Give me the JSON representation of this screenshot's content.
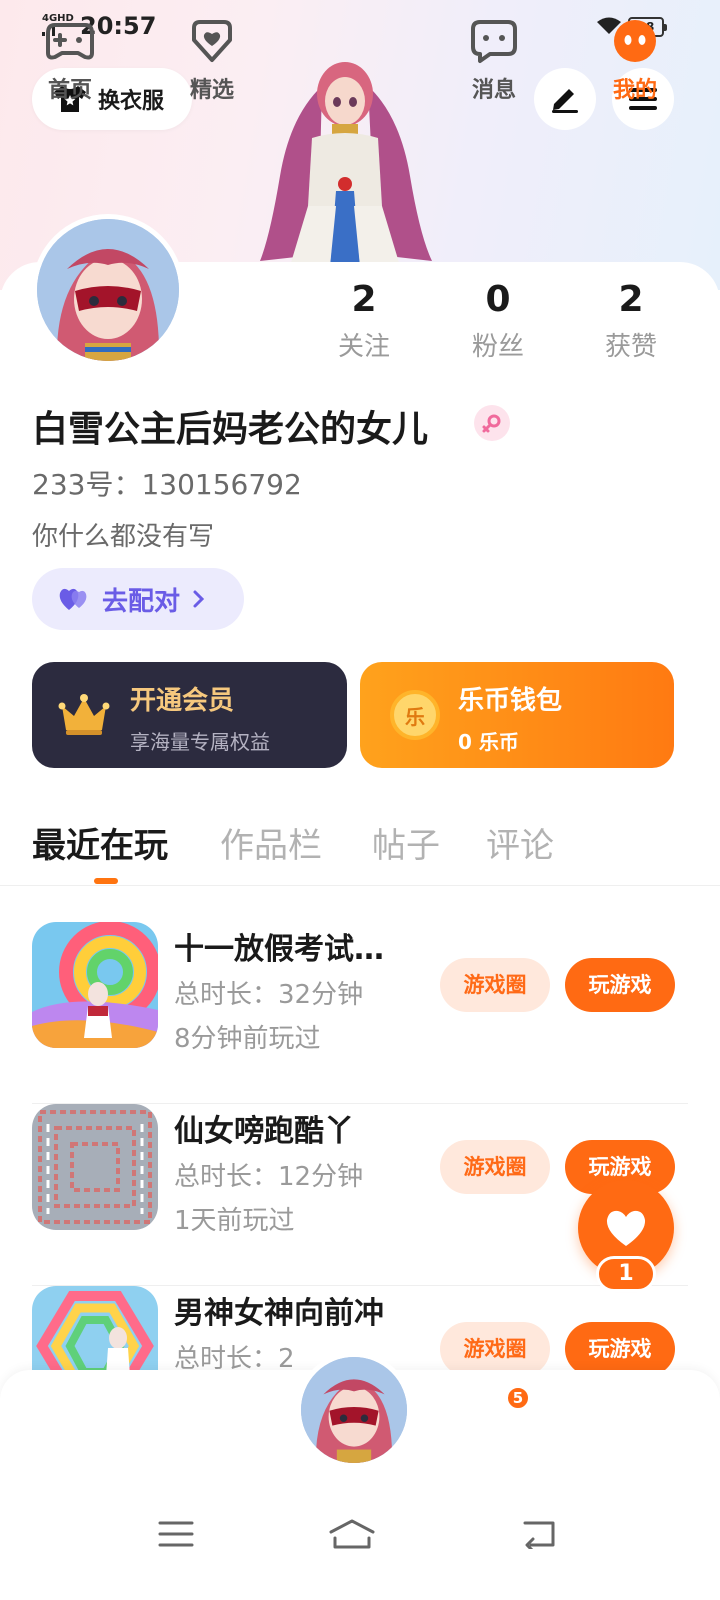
{
  "status_bar": {
    "network": "4GHD",
    "time": "20:57",
    "battery": "48"
  },
  "header": {
    "outfit_button": "换衣服"
  },
  "profile": {
    "stats": [
      {
        "value": "2",
        "label": "关注"
      },
      {
        "value": "0",
        "label": "粉丝"
      },
      {
        "value": "2",
        "label": "获赞"
      }
    ],
    "nickname": "白雪公主后妈老公的女儿",
    "gender_icon": "female-icon",
    "uid": "233号：130156792",
    "bio": "你什么都没有写",
    "match_button": "去配对"
  },
  "cards": {
    "vip": {
      "title": "开通会员",
      "subtitle": "享海量专属权益"
    },
    "wallet": {
      "title": "乐币钱包",
      "subtitle": "0 乐币",
      "coin_glyph": "乐"
    }
  },
  "tabs": [
    {
      "label": "最近在玩",
      "active": true
    },
    {
      "label": "作品栏",
      "active": false
    },
    {
      "label": "帖子",
      "active": false
    },
    {
      "label": "评论",
      "active": false
    }
  ],
  "games": [
    {
      "title": "十一放假考试…",
      "duration": "总时长：32分钟",
      "last_played": "8分钟前玩过",
      "circle_label": "游戏圈",
      "play_label": "玩游戏"
    },
    {
      "title": "仙女嗙跑酷丫",
      "duration": "总时长：12分钟",
      "last_played": "1天前玩过",
      "circle_label": "游戏圈",
      "play_label": "玩游戏"
    },
    {
      "title": "男神女神向前冲",
      "duration": "总时长：2",
      "last_played": "",
      "circle_label": "游戏圈",
      "play_label": "玩游戏"
    }
  ],
  "floating_like": {
    "count": "1"
  },
  "bottom_tabs": [
    {
      "label": "首页",
      "icon": "gamepad-icon"
    },
    {
      "label": "精选",
      "icon": "heart-tag-icon"
    },
    {
      "label": "消息",
      "icon": "chat-icon",
      "badge": "5"
    },
    {
      "label": "我的",
      "icon": "profile-face-icon",
      "active": true
    }
  ],
  "colors": {
    "accent": "#ff6a13",
    "vip_gold": "#f6c87e",
    "match_purple": "#6a5ce6"
  }
}
